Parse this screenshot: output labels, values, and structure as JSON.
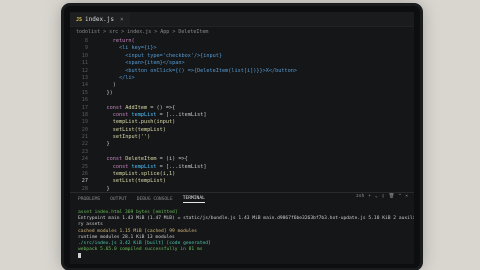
{
  "editor": {
    "tab_label": "index.js",
    "tab_badge": "JS",
    "breadcrumb": [
      "todolist",
      "src",
      "index.js",
      "App",
      "DeleteItem"
    ],
    "lines": [
      {
        "n": "8",
        "parts": [
          {
            "t": "      return(",
            "c": "kw"
          }
        ]
      },
      {
        "n": "9",
        "parts": [
          {
            "t": "        <li key={i}>",
            "c": "tag"
          }
        ]
      },
      {
        "n": "10",
        "parts": [
          {
            "t": "          <input type='checkbox'/>{input}",
            "c": "tag"
          }
        ]
      },
      {
        "n": "11",
        "parts": [
          {
            "t": "          <span>{item}</span>",
            "c": "tag"
          }
        ]
      },
      {
        "n": "12",
        "parts": [
          {
            "t": "          <button onClick={() =>{DeleteItem(list[i])}}>X</button>",
            "c": "tag"
          }
        ]
      },
      {
        "n": "13",
        "parts": [
          {
            "t": "        </li>",
            "c": "tag"
          }
        ]
      },
      {
        "n": "14",
        "parts": [
          {
            "t": "      )",
            "c": "code"
          }
        ]
      },
      {
        "n": "15",
        "parts": [
          {
            "t": "    })",
            "c": "code"
          }
        ]
      },
      {
        "n": "16",
        "parts": [
          {
            "t": "",
            "c": "code"
          }
        ]
      },
      {
        "n": "17",
        "parts": [
          {
            "t": "    const ",
            "c": "kw"
          },
          {
            "t": "AddItem",
            "c": "fn"
          },
          {
            "t": " = () =>{",
            "c": "code"
          }
        ]
      },
      {
        "n": "18",
        "parts": [
          {
            "t": "      const ",
            "c": "kw"
          },
          {
            "t": "tempList",
            "c": "var"
          },
          {
            "t": " = [...itemList]",
            "c": "code"
          }
        ]
      },
      {
        "n": "19",
        "parts": [
          {
            "t": "      tempList.push(input)",
            "c": "fn"
          }
        ]
      },
      {
        "n": "20",
        "parts": [
          {
            "t": "      setList(tempList)",
            "c": "fn"
          }
        ]
      },
      {
        "n": "21",
        "parts": [
          {
            "t": "      setInput('')",
            "c": "fn"
          }
        ]
      },
      {
        "n": "22",
        "parts": [
          {
            "t": "    }",
            "c": "code"
          }
        ]
      },
      {
        "n": "23",
        "parts": [
          {
            "t": "",
            "c": "code"
          }
        ]
      },
      {
        "n": "24",
        "parts": [
          {
            "t": "    const ",
            "c": "kw"
          },
          {
            "t": "DeleteItem",
            "c": "fn"
          },
          {
            "t": " = (i) =>{",
            "c": "code"
          }
        ]
      },
      {
        "n": "25",
        "parts": [
          {
            "t": "      const ",
            "c": "kw"
          },
          {
            "t": "tempList",
            "c": "var"
          },
          {
            "t": " = [...itemList]",
            "c": "code"
          }
        ]
      },
      {
        "n": "26",
        "parts": [
          {
            "t": "      tempList.splice(i,1)",
            "c": "fn"
          }
        ]
      },
      {
        "n": "27",
        "parts": [
          {
            "t": "      setList(tempList)",
            "c": "fn"
          }
        ],
        "current": true
      },
      {
        "n": "28",
        "parts": [
          {
            "t": "    }",
            "c": "code"
          }
        ]
      }
    ]
  },
  "panel": {
    "tabs": [
      "PROBLEMS",
      "OUTPUT",
      "DEBUG CONSOLE",
      "TERMINAL"
    ],
    "active": "TERMINAL",
    "actions": [
      "zsh",
      "+",
      "⌄",
      "▯",
      "🗑",
      "^",
      "×"
    ]
  },
  "terminal": {
    "lines": [
      {
        "t": "asset index.html 369 bytes [emitted]",
        "c": "green"
      },
      {
        "t": "Entrypoint main 1.43 MiB (1.47 MiB) = static/js/bundle.js 1.43 MiB main.d9867f6be3263bf7b3.hot-update.js 5.18 KiB 2 auxilia",
        "c": "code"
      },
      {
        "t": "ry assets",
        "c": "code"
      },
      {
        "t": "cached modules 1.15 MiB [cached] 99 modules",
        "c": "yellow"
      },
      {
        "t": "runtime modules 28.1 KiB 13 modules",
        "c": "code"
      },
      {
        "t": "./src/index.js 3.42 KiB [built] [code generated]",
        "c": "cyan"
      },
      {
        "t": "webpack 5.65.0 compiled successfully in 81 ms",
        "c": "green"
      }
    ]
  }
}
